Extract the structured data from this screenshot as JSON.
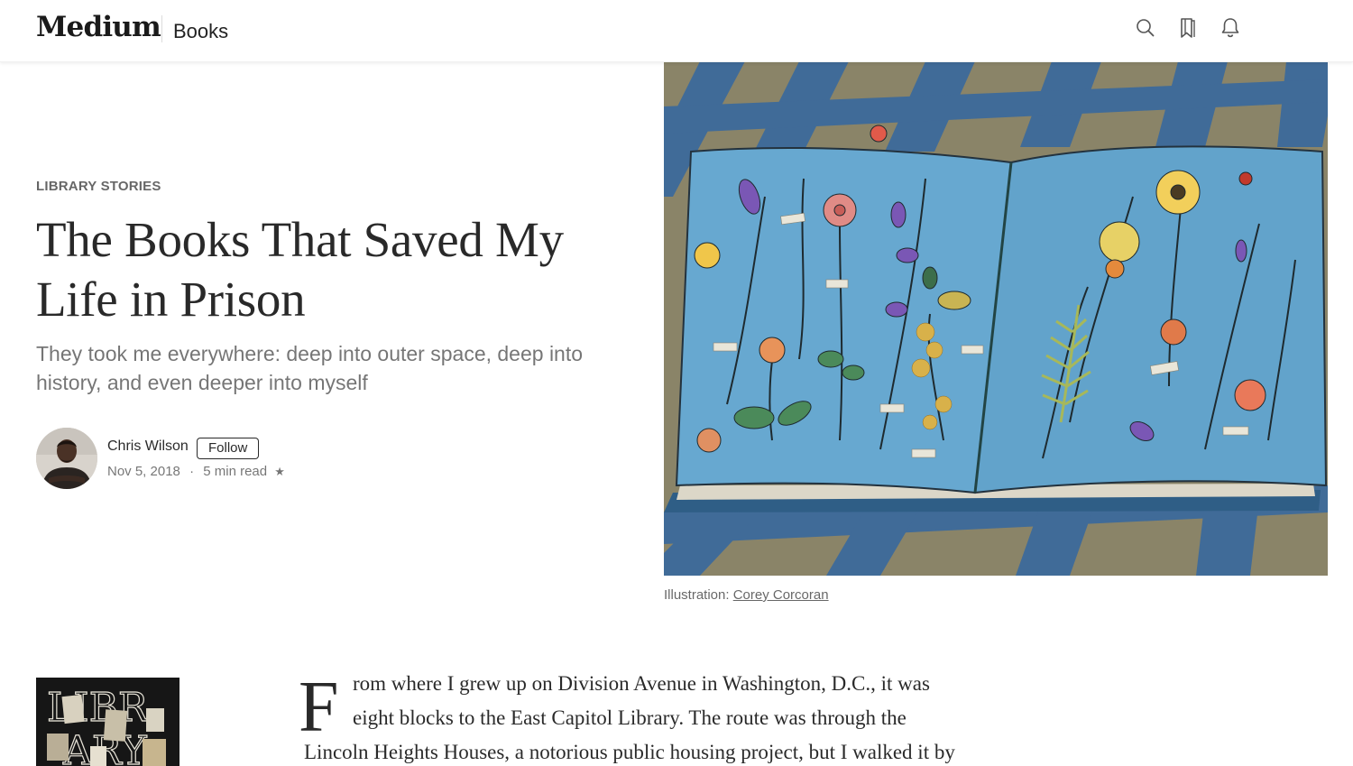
{
  "header": {
    "logo": "Medium",
    "section": "Books",
    "icons": [
      "search-icon",
      "bookmarks-icon",
      "notifications-icon"
    ]
  },
  "article": {
    "kicker": "LIBRARY STORIES",
    "title": "The Books That Saved My Life in Prison",
    "subtitle": "They took me everywhere: deep into outer space, deep into history, and even deeper into myself",
    "author": {
      "name": "Chris Wilson",
      "follow_label": "Follow",
      "date": "Nov 5, 2018",
      "separator": "·",
      "read_time": "5 min read",
      "star": "★"
    },
    "caption": {
      "prefix": "Illustration: ",
      "credit": "Corey Corcoran"
    },
    "body": {
      "dropcap": "F",
      "lines": [
        "rom where I grew up on Division Avenue in Washington, D.C., it was",
        "eight blocks to the East Capitol Library. The route was through the",
        "Lincoln Heights Houses, a notorious public housing project, but I walked it by"
      ]
    }
  },
  "colors": {
    "text": "#1f1f1f",
    "hero_blue": "#5d9cc4",
    "floor_tan": "#8b8266"
  }
}
